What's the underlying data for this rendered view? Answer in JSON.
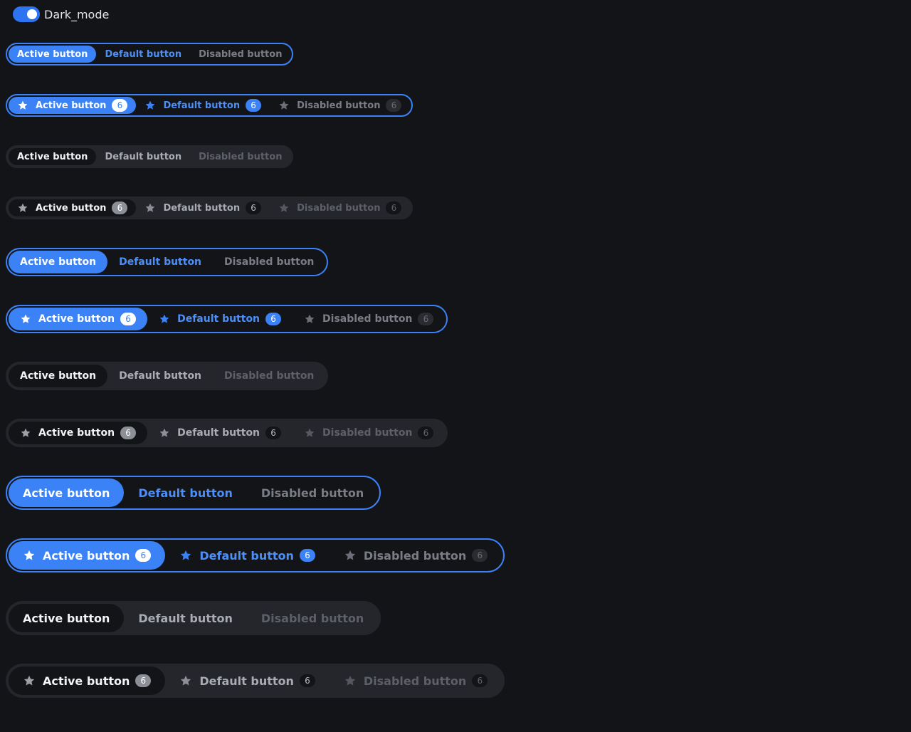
{
  "toggle": {
    "label": "Dark_mode",
    "on": true
  },
  "buttons": {
    "active": "Active button",
    "default": "Default button",
    "disabled": "Disabled button",
    "count": "6"
  },
  "colors": {
    "accent": "#3b82f6",
    "background": "#131418",
    "group_fill": "#24262b"
  },
  "icons": {
    "button_icon": "star-icon"
  },
  "groups": [
    {
      "variant": "outline",
      "size": "small",
      "icons": false
    },
    {
      "variant": "outline",
      "size": "small",
      "icons": true
    },
    {
      "variant": "filled",
      "size": "small",
      "icons": false
    },
    {
      "variant": "filled",
      "size": "small",
      "icons": true
    },
    {
      "variant": "outline",
      "size": "medium",
      "icons": false
    },
    {
      "variant": "outline",
      "size": "medium",
      "icons": true
    },
    {
      "variant": "filled",
      "size": "medium",
      "icons": false
    },
    {
      "variant": "filled",
      "size": "medium",
      "icons": true
    },
    {
      "variant": "outline",
      "size": "large",
      "icons": false
    },
    {
      "variant": "outline",
      "size": "large",
      "icons": true
    },
    {
      "variant": "filled",
      "size": "large",
      "icons": false
    },
    {
      "variant": "filled",
      "size": "large",
      "icons": true
    }
  ]
}
